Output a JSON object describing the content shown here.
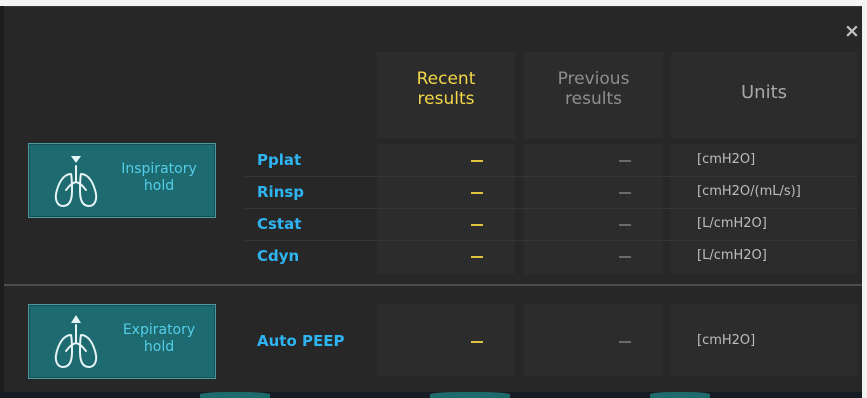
{
  "dialog": {
    "close_glyph": "×"
  },
  "columns": {
    "recent": "Recent results",
    "recent_line1": "Recent",
    "recent_line2": "results",
    "previous_line1": "Previous",
    "previous_line2": "results",
    "units": "Units"
  },
  "inspiratory": {
    "button_line1": "Inspiratory",
    "button_line2": "hold",
    "icon": "lungs-inhale-icon",
    "rows": [
      {
        "name": "Pplat",
        "recent": "–",
        "previous": "–",
        "unit": "[cmH2O]"
      },
      {
        "name": "Rinsp",
        "recent": "–",
        "previous": "–",
        "unit": "[cmH2O/(mL/s)]"
      },
      {
        "name": "Cstat",
        "recent": "–",
        "previous": "–",
        "unit": "[L/cmH2O]"
      },
      {
        "name": "Cdyn",
        "recent": "–",
        "previous": "–",
        "unit": "[L/cmH2O]"
      }
    ]
  },
  "expiratory": {
    "button_line1": "Expiratory",
    "button_line2": "hold",
    "icon": "lungs-exhale-icon",
    "rows": [
      {
        "name": "Auto PEEP",
        "recent": "–",
        "previous": "–",
        "unit": "[cmH2O]"
      }
    ]
  },
  "colors": {
    "panel": "#272727",
    "column_cell": "#2c2c2c",
    "button": "#1d6a70",
    "button_text": "#56cde8",
    "param_text": "#2fb4f2",
    "recent_header": "#f3d84a",
    "muted_header": "#8e8e8e",
    "unit_text": "#bdbdbd"
  }
}
